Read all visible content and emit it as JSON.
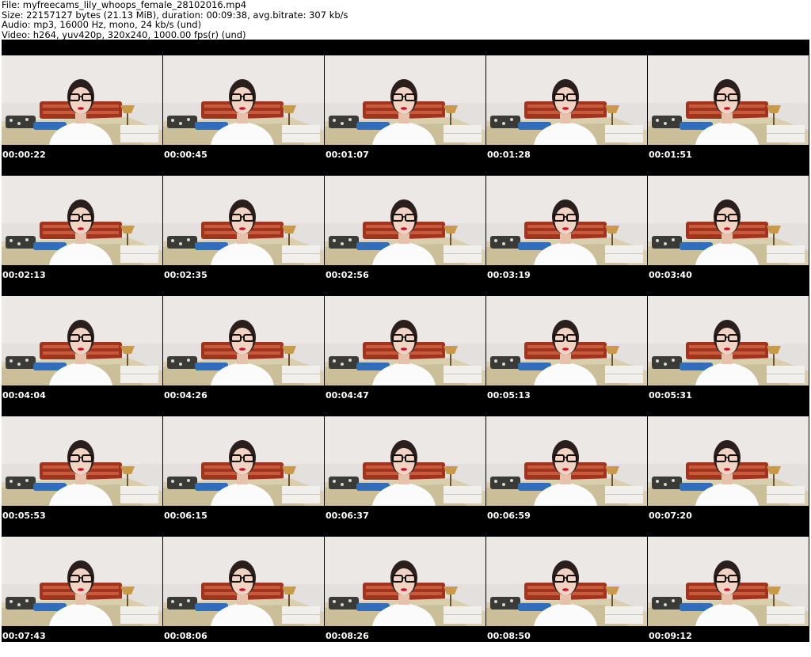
{
  "header": {
    "file_line": "File: myfreecams_lily_whoops_female_28102016.mp4",
    "size_line": "Size: 22157127 bytes (21.13 MiB), duration: 00:09:38, avg.bitrate: 307 kb/s",
    "audio_line": "Audio: mp3, 16000 Hz, mono, 24 kb/s (und)",
    "video_line": "Video: h264, yuv420p, 320x240, 1000.00 fps(r) (und)"
  },
  "thumbnails": [
    {
      "timestamp": "00:00:22"
    },
    {
      "timestamp": "00:00:45"
    },
    {
      "timestamp": "00:01:07"
    },
    {
      "timestamp": "00:01:28"
    },
    {
      "timestamp": "00:01:51"
    },
    {
      "timestamp": "00:02:13"
    },
    {
      "timestamp": "00:02:35"
    },
    {
      "timestamp": "00:02:56"
    },
    {
      "timestamp": "00:03:19"
    },
    {
      "timestamp": "00:03:40"
    },
    {
      "timestamp": "00:04:04"
    },
    {
      "timestamp": "00:04:26"
    },
    {
      "timestamp": "00:04:47"
    },
    {
      "timestamp": "00:05:13"
    },
    {
      "timestamp": "00:05:31"
    },
    {
      "timestamp": "00:05:53"
    },
    {
      "timestamp": "00:06:15"
    },
    {
      "timestamp": "00:06:37"
    },
    {
      "timestamp": "00:06:59"
    },
    {
      "timestamp": "00:07:20"
    },
    {
      "timestamp": "00:07:43"
    },
    {
      "timestamp": "00:08:06"
    },
    {
      "timestamp": "00:08:26"
    },
    {
      "timestamp": "00:08:50"
    },
    {
      "timestamp": "00:09:12"
    }
  ],
  "colors": {
    "sheet_background": "#000000",
    "timestamp_text": "#ffffff",
    "header_text": "#000000"
  }
}
